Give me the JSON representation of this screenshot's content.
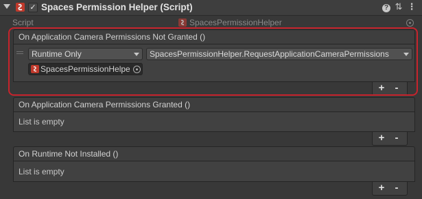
{
  "component": {
    "title": "Spaces Permission Helper (Script)",
    "enabled_checkmark": "✓",
    "icons": [
      "script-icon",
      "help-icon",
      "settings-sliders-icon",
      "more-menu-icon"
    ],
    "help_glyph": "?",
    "settings_glyph": "⇅",
    "more_glyph": "⋮"
  },
  "script_field": {
    "label": "Script",
    "value": "SpacesPermissionHelper"
  },
  "events": [
    {
      "header": "On Application Camera Permissions Not Granted ()",
      "listener": {
        "runtime_mode": "Runtime Only",
        "function": "SpacesPermissionHelper.RequestApplicationCameraPermissions",
        "target_object": "SpacesPermissionHelpe"
      }
    },
    {
      "header": "On Application Camera Permissions Granted ()",
      "empty_text": "List is empty"
    },
    {
      "header": "On Runtime Not Installed ()",
      "empty_text": "List is empty"
    }
  ],
  "buttons": {
    "plus": "+",
    "minus": "-"
  },
  "colors": {
    "background": "#383838",
    "highlight_outline": "#c8232c",
    "script_icon_red": "#c0392b"
  }
}
